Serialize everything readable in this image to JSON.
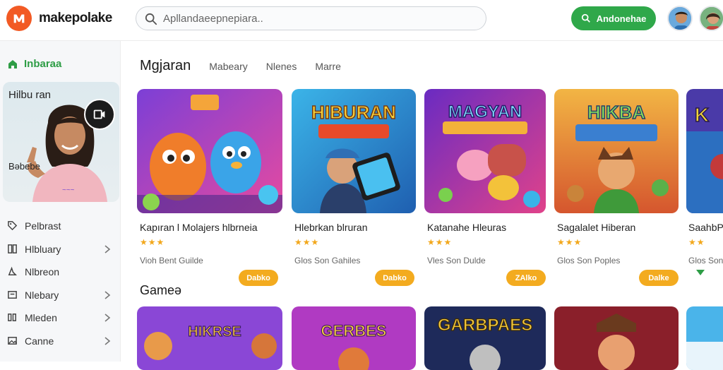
{
  "header": {
    "brand": "makepolake",
    "search_placeholder": "Apllandaeepnepiara..",
    "cta_label": "Andonehae",
    "colors": {
      "brand": "#f25a24",
      "cta": "#2fa84a",
      "accent": "#f3ab1f"
    }
  },
  "sidebar": {
    "top_label": "Inbaraa",
    "promo": {
      "title": "Hilbu ran",
      "sub": "Bəbebe"
    },
    "items": [
      {
        "label": "Pelbrast",
        "icon": "tag-icon",
        "chevron": false
      },
      {
        "label": "Hlbluary",
        "icon": "grid-icon",
        "chevron": true
      },
      {
        "label": "Nlbreon",
        "icon": "compass-icon",
        "chevron": false
      },
      {
        "label": "Nlebary",
        "icon": "box-icon",
        "chevron": true
      },
      {
        "label": "Mleden",
        "icon": "columns-icon",
        "chevron": true
      },
      {
        "label": "Canne",
        "icon": "image-icon",
        "chevron": true
      }
    ]
  },
  "main": {
    "tabs": [
      "Mgjaran",
      "Mabeary",
      "Nlenes",
      "Marre"
    ],
    "cards": [
      {
        "title": "Kapıran l Molajers hlbrneia",
        "stars": "★★★",
        "meta": "Vioh Bent Guilde",
        "pill": "Dabko",
        "art_text": ""
      },
      {
        "title": "Hlebrkan blruran",
        "stars": "★★★",
        "meta": "Glos Son Gahiles",
        "pill": "Dabko",
        "art_text": "HIBURAN"
      },
      {
        "title": "Katanahe Hleuras",
        "stars": "★★★",
        "meta": "Vles Son Dulde",
        "pill": "ZAlko",
        "art_text": "MAGYAN"
      },
      {
        "title": "Sagalalet Hiberan",
        "stars": "★★★",
        "meta": "Glos Son Poples",
        "pill": "Dalke",
        "art_text": "HIKBA"
      },
      {
        "title": "SaahbPlr",
        "stars": "★★",
        "meta": "Glos Son",
        "pill": "",
        "art_text": "K"
      }
    ],
    "section_title": "Gameə",
    "second_row": [
      {
        "art_text": "HIKRSE"
      },
      {
        "art_text": "GERBES"
      },
      {
        "art_text": "GARBPAES"
      },
      {
        "art_text": ""
      },
      {
        "art_text": ""
      }
    ]
  }
}
